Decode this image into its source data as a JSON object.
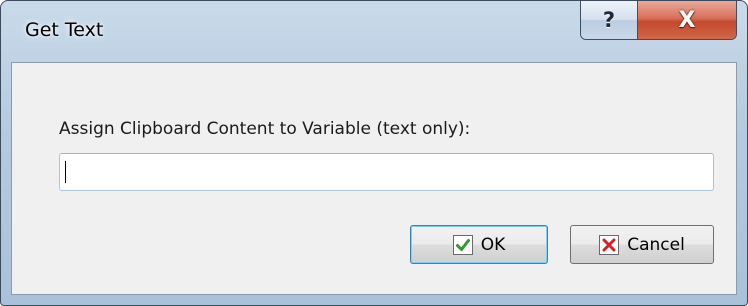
{
  "window": {
    "title": "Get Text",
    "help_glyph": "?",
    "close_glyph": "X",
    "close_color": "#c44a2d"
  },
  "form": {
    "prompt": "Assign Clipboard Content to Variable (text only):",
    "variable_value": ""
  },
  "buttons": {
    "ok_label": "OK",
    "ok_icon": "checkmark-icon",
    "ok_icon_color": "#2e9a2e",
    "cancel_label": "Cancel",
    "cancel_icon": "red-x-icon",
    "cancel_icon_color": "#d42020"
  }
}
